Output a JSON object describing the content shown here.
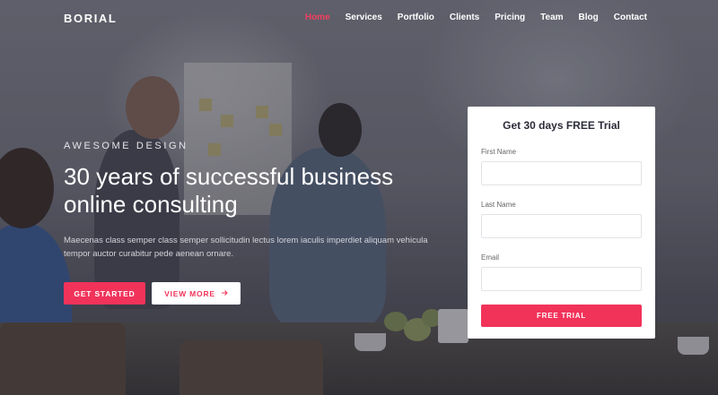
{
  "brand": {
    "logo": "BORIAL",
    "accent_color": "#f1335a"
  },
  "nav": {
    "items": [
      {
        "label": "Home",
        "active": true
      },
      {
        "label": "Services",
        "active": false
      },
      {
        "label": "Portfolio",
        "active": false
      },
      {
        "label": "Clients",
        "active": false
      },
      {
        "label": "Pricing",
        "active": false
      },
      {
        "label": "Team",
        "active": false
      },
      {
        "label": "Blog",
        "active": false
      },
      {
        "label": "Contact",
        "active": false
      }
    ]
  },
  "hero": {
    "eyebrow": "AWESOME DESIGN",
    "headline": "30 years of successful business online consulting",
    "description": "Maecenas class semper class semper sollicitudin lectus lorem iaculis imperdiet aliquam vehicula tempor auctor curabitur pede aenean ornare.",
    "primary_button": "GET STARTED",
    "secondary_button": "VIEW MORE",
    "secondary_button_icon": "arrow-right-icon"
  },
  "form": {
    "title": "Get 30 days FREE Trial",
    "fields": [
      {
        "label": "First Name",
        "value": ""
      },
      {
        "label": "Last Name",
        "value": ""
      },
      {
        "label": "Email",
        "value": ""
      }
    ],
    "submit_label": "FREE TRIAL"
  }
}
